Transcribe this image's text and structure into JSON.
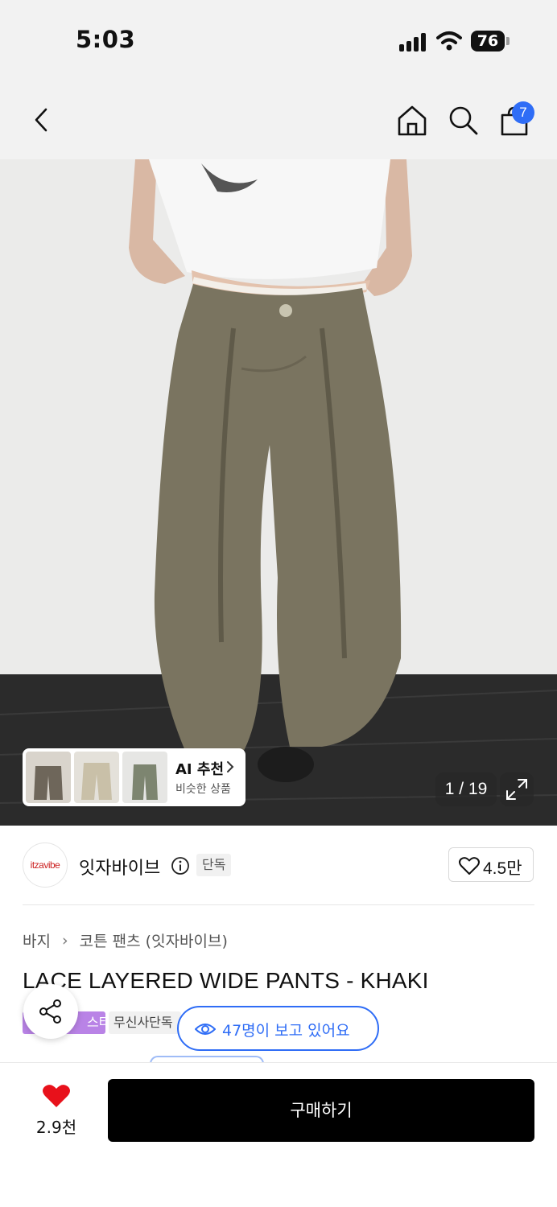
{
  "status_bar": {
    "time": "5:03",
    "battery": "76"
  },
  "header": {
    "cart_count": "7"
  },
  "icons": {
    "back": "chevron-left-icon",
    "home": "home-icon",
    "search": "search-icon",
    "cart": "shopping-bag-icon",
    "info": "info-icon",
    "like": "heart-outline-icon",
    "share": "share-icon",
    "eye": "eye-icon",
    "expand": "expand-icon",
    "wish": "heart-filled-icon"
  },
  "gallery": {
    "ai_title": "AI 추천",
    "ai_subtitle": "비슷한 상품",
    "counter": "1 / 19"
  },
  "brand": {
    "logo_text": "itzavibe",
    "name": "잇자바이브",
    "badge": "단독",
    "likes": "4.5만"
  },
  "breadcrumb": {
    "category": "바지",
    "subcategory": "코튼 팬츠 (잇자바이브)"
  },
  "product": {
    "title": "LACE LAYERED WIDE PANTS - KHAKI",
    "tag_purple": "스타",
    "tag_gray": "무신사단독"
  },
  "viewers": "47명이 보고 있어요",
  "bottom": {
    "wish_count": "2.9천",
    "buy_label": "구매하기"
  },
  "colors": {
    "accent_blue": "#2f6df6",
    "heart_red": "#e8111b",
    "tag_purple": "#b983e6",
    "pants_khaki": "#7a7460"
  }
}
